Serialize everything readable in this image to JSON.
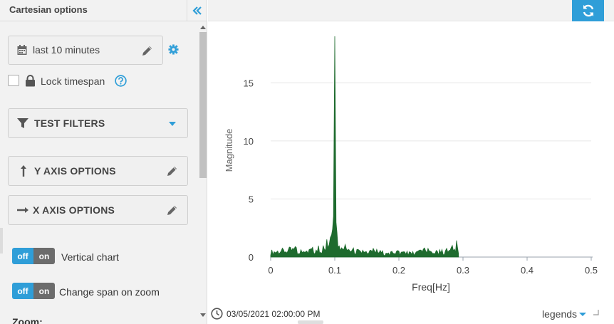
{
  "sidebar": {
    "title": "Cartesian options",
    "timespan": {
      "label": "last 10 minutes"
    },
    "lock": {
      "label": "Lock timespan",
      "checked": false
    },
    "filters": {
      "title": "TEST FILTERS"
    },
    "y_axis": {
      "title": "Y AXIS OPTIONS"
    },
    "x_axis": {
      "title": "X AXIS OPTIONS"
    },
    "toggles": [
      {
        "off": "off",
        "on": "on",
        "label": "Vertical chart",
        "state": "off"
      },
      {
        "off": "off",
        "on": "on",
        "label": "Change span on zoom",
        "state": "off"
      }
    ],
    "zoom_label": "Zoom:"
  },
  "footer": {
    "timestamp": "03/05/2021 02:00:00 PM",
    "legends_label": "legends"
  },
  "colors": {
    "accent": "#2f9ed8",
    "series": "#1e6b2e",
    "toggle_on": "#6c6c6c"
  },
  "icons": {
    "collapse": "double-chevron-left-icon",
    "calendar": "calendar-icon",
    "edit": "pencil-icon",
    "settings": "gear-icon",
    "lock": "lock-icon",
    "help": "question-circle-icon",
    "filter": "filter-icon",
    "y_axis": "arrow-up-icon",
    "x_axis": "arrow-right-icon",
    "refresh": "refresh-icon",
    "clock": "clock-icon"
  },
  "chart_data": {
    "type": "line",
    "xlabel": "Freq[Hz]",
    "ylabel": "Magnitude",
    "xlim": [
      0,
      0.5
    ],
    "ylim": [
      0,
      19
    ],
    "x_ticks": [
      "0",
      "0.1",
      "0.2",
      "0.3",
      "0.4",
      "0.5"
    ],
    "y_ticks": [
      "0",
      "5",
      "10",
      "15"
    ],
    "grid": "horizontal",
    "series": [
      {
        "x": [
          0,
          0.02,
          0.04,
          0.06,
          0.08,
          0.095,
          0.098,
          0.1,
          0.102,
          0.105,
          0.12,
          0.14,
          0.16,
          0.18,
          0.2,
          0.22,
          0.24,
          0.26,
          0.28,
          0.29,
          0.293
        ],
        "y": [
          0.4,
          0.5,
          0.6,
          0.5,
          0.7,
          1.3,
          3.5,
          19,
          3.0,
          1.2,
          0.6,
          0.4,
          0.5,
          0.3,
          0.4,
          0.3,
          0.5,
          0.4,
          0.5,
          0.9,
          0.3
        ]
      }
    ]
  }
}
